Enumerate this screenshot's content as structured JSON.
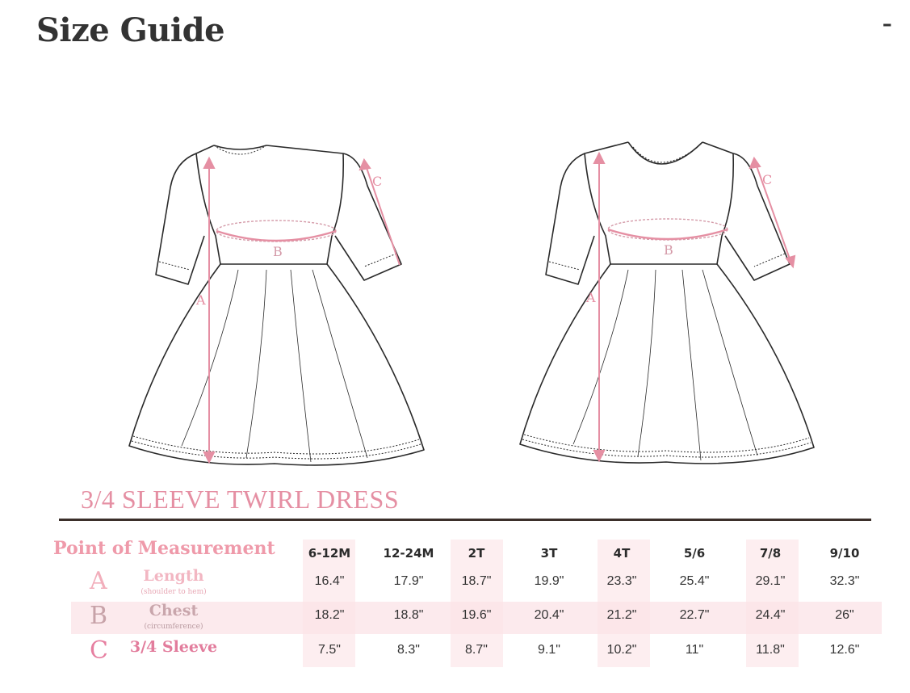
{
  "header": {
    "title": "Size Guide",
    "collapse_label": "-"
  },
  "diagram": {
    "label_a": "A",
    "label_b": "B",
    "label_c": "C"
  },
  "product_name": "3/4 SLEEVE TWIRL DRESS",
  "table": {
    "header_label": "Point of Measurement",
    "sizes": [
      "6-12M",
      "12-24M",
      "2T",
      "3T",
      "4T",
      "5/6",
      "7/8",
      "9/10"
    ],
    "rows": [
      {
        "letter": "A",
        "name": "Length",
        "sub": "(shoulder to hem)",
        "values": [
          "16.4\"",
          "17.9\"",
          "18.7\"",
          "19.9\"",
          "23.3\"",
          "25.4\"",
          "29.1\"",
          "32.3\""
        ]
      },
      {
        "letter": "B",
        "name": "Chest",
        "sub": "(circumference)",
        "values": [
          "18.2\"",
          "18.8\"",
          "19.6\"",
          "20.4\"",
          "21.2\"",
          "22.7\"",
          "24.4\"",
          "26\""
        ]
      },
      {
        "letter": "C",
        "name": "3/4 Sleeve",
        "sub": "",
        "values": [
          "7.5\"",
          "8.3\"",
          "8.7\"",
          "9.1\"",
          "10.2\"",
          "11\"",
          "11.8\"",
          "12.6\""
        ]
      }
    ]
  },
  "colors": {
    "accent": "#e58fa3",
    "rule": "#3b2f2a",
    "shade": "#fdeef0"
  }
}
